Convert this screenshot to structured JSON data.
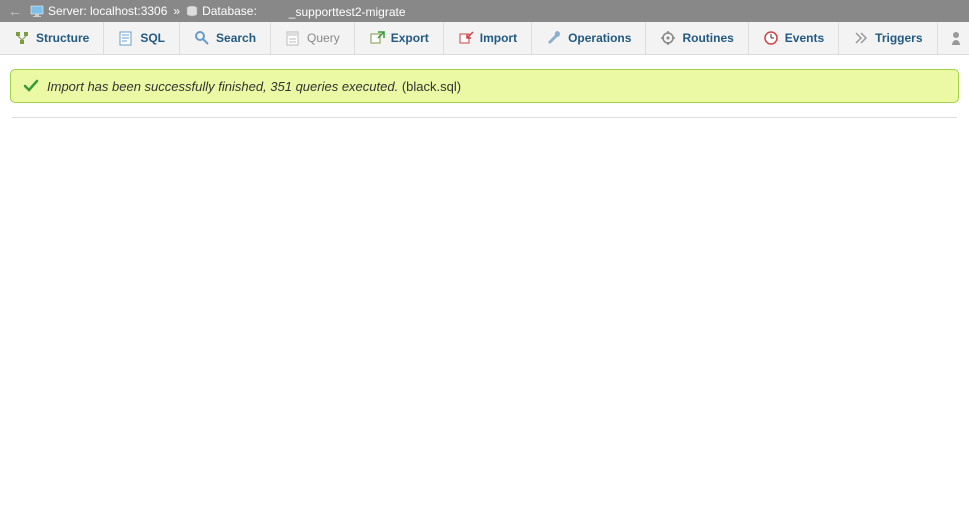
{
  "breadcrumb": {
    "server_label": "Server: localhost:3306",
    "separator": "»",
    "database_label": "Database:",
    "database_name_suffix": "_supporttest2-migrate"
  },
  "tabs": {
    "structure": "Structure",
    "sql": "SQL",
    "search": "Search",
    "query": "Query",
    "export": "Export",
    "import": "Import",
    "operations": "Operations",
    "routines": "Routines",
    "events": "Events",
    "triggers": "Triggers"
  },
  "message": {
    "text_italic": "Import has been successfully finished, 351 queries executed.",
    "text_plain": "(black.sql)"
  }
}
